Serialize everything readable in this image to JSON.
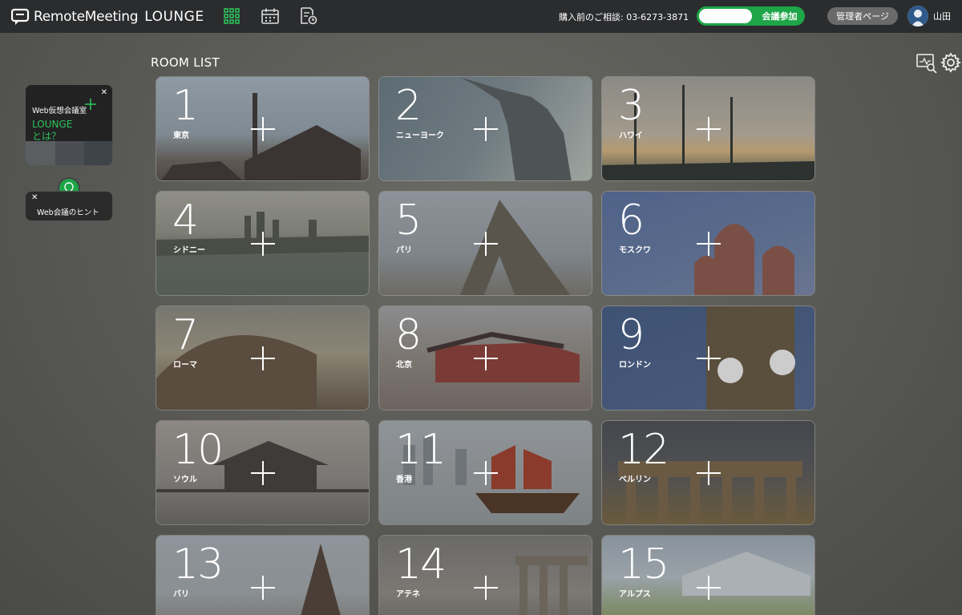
{
  "header": {
    "brand": "RemoteMeeting",
    "product": "LOUNGE",
    "contact": "購入前のご相談: 03-6273-3871",
    "join_placeholder": "",
    "join_label": "会議参加",
    "admin_label": "管理者ページ",
    "user_name": "山田",
    "nav_icons": [
      "grid-icon",
      "calendar-icon",
      "report-icon"
    ],
    "accent": "#1da548"
  },
  "main": {
    "title": "ROOM LIST",
    "rooms": [
      {
        "number": "1",
        "city": "東京"
      },
      {
        "number": "2",
        "city": "ニューヨーク"
      },
      {
        "number": "3",
        "city": "ハワイ"
      },
      {
        "number": "4",
        "city": "シドニー"
      },
      {
        "number": "5",
        "city": "パリ"
      },
      {
        "number": "6",
        "city": "モスクワ"
      },
      {
        "number": "7",
        "city": "ローマ"
      },
      {
        "number": "8",
        "city": "北京"
      },
      {
        "number": "9",
        "city": "ロンドン"
      },
      {
        "number": "10",
        "city": "ソウル"
      },
      {
        "number": "11",
        "city": "香港"
      },
      {
        "number": "12",
        "city": "ベルリン"
      },
      {
        "number": "13",
        "city": "バリ"
      },
      {
        "number": "14",
        "city": "アテネ"
      },
      {
        "number": "15",
        "city": "アルプス"
      }
    ]
  },
  "sidebar": {
    "promo_line1": "Web仮想会議室",
    "promo_line2": "LOUNGE",
    "promo_line3": "とは？",
    "hint_label": "Web会議のヒント",
    "close_symbol": "✕"
  }
}
